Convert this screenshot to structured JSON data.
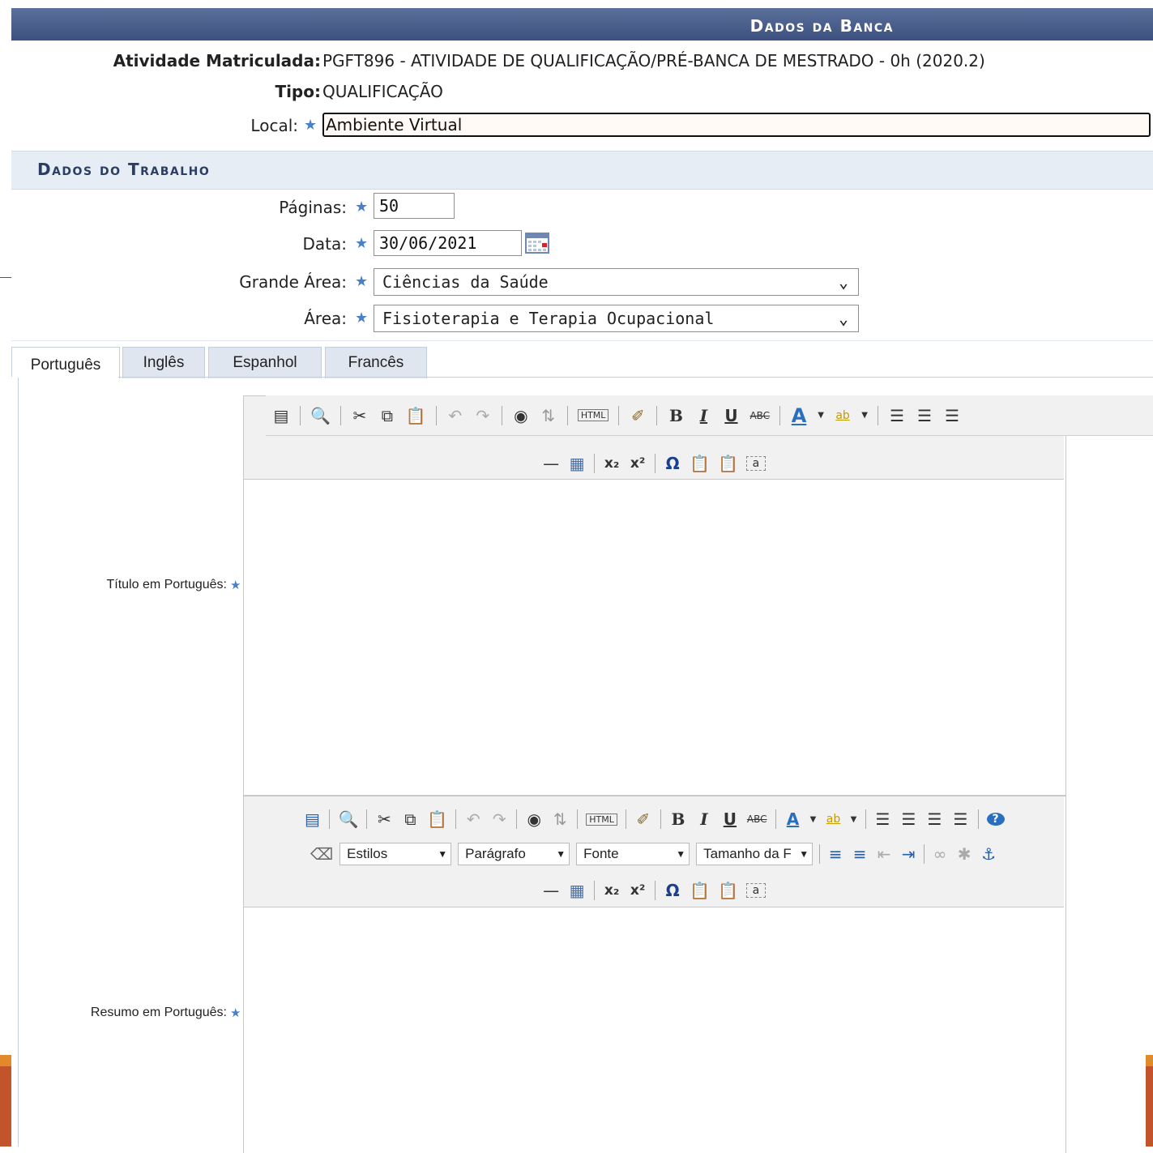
{
  "banca": {
    "header_title": "Dados da Banca",
    "atividade_label": "Atividade Matriculada:",
    "atividade_value": "PGFT896 - ATIVIDADE DE QUALIFICAÇÃO/PRÉ-BANCA DE MESTRADO - 0h (2020.2)",
    "tipo_label": "Tipo:",
    "tipo_value": "QUALIFICAÇÃO",
    "local_label": "Local:",
    "local_value": "Ambiente Virtual"
  },
  "trabalho": {
    "header_title": "Dados do Trabalho",
    "paginas_label": "Páginas:",
    "paginas_value": "50",
    "data_label": "Data:",
    "data_value": "30/06/2021",
    "grande_area_label": "Grande Área:",
    "grande_area_value": "Ciências da Saúde",
    "area_label": "Área:",
    "area_value": "Fisioterapia e Terapia Ocupacional"
  },
  "tabs": [
    {
      "label": "Português",
      "active": true
    },
    {
      "label": "Inglês",
      "active": false
    },
    {
      "label": "Espanhol",
      "active": false
    },
    {
      "label": "Francês",
      "active": false
    }
  ],
  "required_marker": "★",
  "editors": {
    "titulo_label": "Título em Português:",
    "resumo_label": "Resumo em Português:",
    "estilos": "Estilos",
    "paragrafo": "Parágrafo",
    "fonte": "Fonte",
    "tamanho": "Tamanho da F",
    "html_button": "HTML",
    "bold": "B",
    "italic": "I",
    "underline": "U",
    "strike": "ABC"
  },
  "colors": {
    "header_bar": "#3d5180",
    "subheader_bg": "#e7edf5",
    "required_star": "#4a7fc9",
    "accent_orange": "#c2532b"
  }
}
